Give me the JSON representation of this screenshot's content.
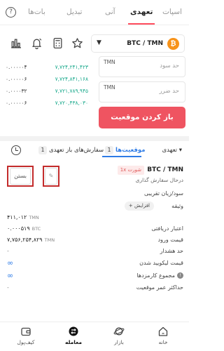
{
  "top_tabs": {
    "help_glyph": "?",
    "items": [
      {
        "label": "اسپات",
        "active": false
      },
      {
        "label": "تعهدی",
        "active": true
      },
      {
        "label": "آنی",
        "active": false
      },
      {
        "label": "تبدیل",
        "active": false
      },
      {
        "label": "بات‌ها",
        "active": false
      }
    ]
  },
  "toolbar_icons": [
    "chart-icon",
    "bell-icon",
    "calculator-icon",
    "star-icon"
  ],
  "pair_select": {
    "pair": "BTC / TMN",
    "coin_glyph": "₿"
  },
  "order_book": [
    {
      "amount": "۰.۰۰۰۰۰۴",
      "price": "۷,۷۲۴,۲۴۱,۴۲۳"
    },
    {
      "amount": "۰.۰۰۰۰۰۶",
      "price": "۷,۷۲۴,۸۴۱,۱۶۸"
    },
    {
      "amount": "۰.۰۰۰۰۳۲",
      "price": "۷,۷۲۱,۷۸۹,۹۴۵"
    },
    {
      "amount": "۰.۰۰۰۰۰۶",
      "price": "۷,۷۲۰,۴۳۸,۰۳۰"
    }
  ],
  "form": {
    "take_profit": {
      "placeholder": "حد سود",
      "unit": "TMN"
    },
    "stop_loss": {
      "placeholder": "حد ضرر",
      "unit": "TMN"
    },
    "open_button": "باز کردن موقعیت"
  },
  "orders_header": {
    "menu_label": "تعهدی ▾",
    "positions_label": "موقعیت‌ها",
    "positions_count": "1",
    "open_orders_label": "سفارش‌های باز تعهدی",
    "open_orders_count": "1"
  },
  "position": {
    "pair": "BTC / TMN",
    "leverage": "1x  شورت",
    "status": "درحال سفارش گذاری",
    "close_label": "بستن",
    "edit_glyph": "✎"
  },
  "details": [
    {
      "key": "سود/زیان تقریبی",
      "value": ""
    },
    {
      "key": "وثیقه",
      "value": "",
      "action": "+ افزایش"
    },
    {
      "key": "",
      "value": "۴۱۱,۰۱۲",
      "unit": "TMN"
    },
    {
      "key": "اعتبار دریافتی",
      "value": "۰.۰۰۰۵۱۹",
      "unit": "BTC"
    },
    {
      "key": "قیمت ورود",
      "value": "۷,۷۵۶,۲۵۴,۸۲۹",
      "unit": "TMN"
    },
    {
      "key": "حد هشدار",
      "value": "-"
    },
    {
      "key": "قیمت لیکویید شدن",
      "value": "∞"
    },
    {
      "key": "مجموع کارمزدها",
      "value": "∞",
      "info": "!"
    },
    {
      "key": "حداکثر عمر موقعیت",
      "value": "-"
    }
  ],
  "bottom_nav": [
    {
      "label": "خانه",
      "icon": "home-icon",
      "active": false
    },
    {
      "label": "بازار",
      "icon": "planet-icon",
      "active": false
    },
    {
      "label": "معامله",
      "icon": "trade-icon",
      "active": true
    },
    {
      "label": "کیف‌پول",
      "icon": "wallet-icon",
      "active": false
    }
  ],
  "colors": {
    "accent_red": "#ef5461",
    "accent_blue": "#2e7be6",
    "bid_green": "#1aa98c"
  }
}
